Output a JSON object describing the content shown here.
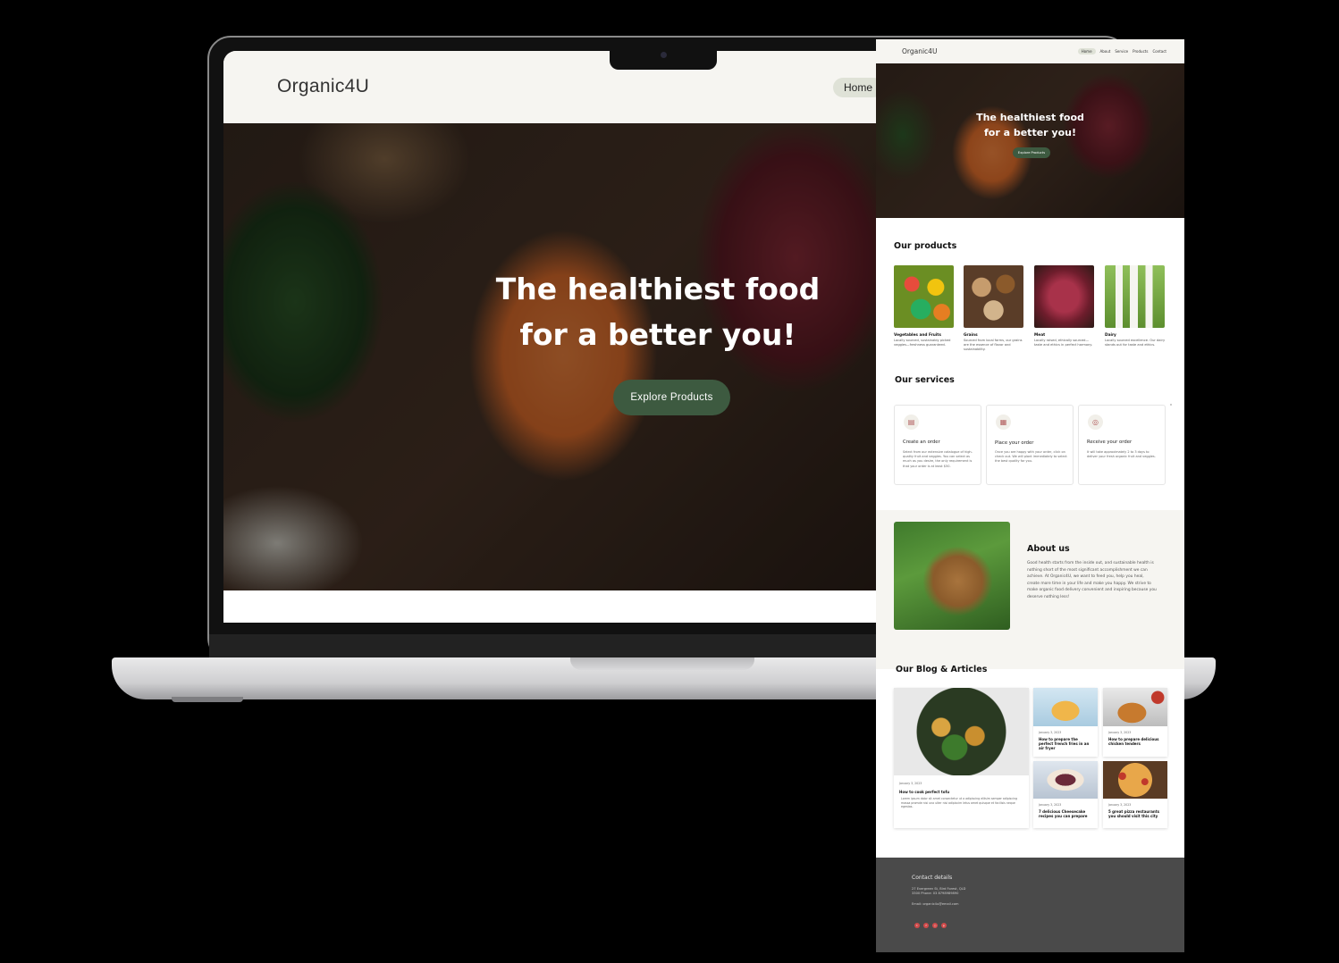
{
  "desktop": {
    "logo": "Organic4U",
    "nav_home": "Home",
    "hero_line1": "The healthiest food",
    "hero_line2": "for a better you!",
    "hero_button": "Explore  Products"
  },
  "page": {
    "logo": "Organic4U",
    "nav": [
      "Home",
      "About",
      "Service",
      "Products",
      "Contact"
    ],
    "hero_line1": "The healthiest food",
    "hero_line2": "for a better you!",
    "hero_button": "Explore  Products",
    "products_title": "Our products",
    "products": [
      {
        "name": "Vegetables and Fruits",
        "desc": "Locally sourced, sustainably picked veggies—freshness guaranteed."
      },
      {
        "name": "Grains",
        "desc": "Sourced from local farms, our grains are the essence of flavor and sustainability."
      },
      {
        "name": "Meat",
        "desc": "Locally raised, ethically sourced—taste and ethics in perfect harmony."
      },
      {
        "name": "Dairy",
        "desc": "Locally sourced excellence. Our dairy stands out for taste and ethics."
      }
    ],
    "services_title": "Our services",
    "services": [
      {
        "title": "Create an order",
        "desc": "Select from our extensive catalogue of high- quality fruit and veggies. You can select as much as you desire, the only requirement is that your order is at least $50."
      },
      {
        "title": "Place your order",
        "desc": "Once you are happy with your order, click on check out. We will plant immediately to select the best quality for you."
      },
      {
        "title": "Receive your order",
        "desc": "It will take approximately 2 to 3 days to deliver your fresh organic fruit and veggies."
      }
    ],
    "about_title": "About us",
    "about_text": "Good health starts from the inside out, and sustainable health is nothing short of the most significant accomplishment we can achieve. At Organic4U, we want to feed you, help you heal, create more time in your life and make you happy. We strive to make organic food delivery convenient and inspiring because you deserve nothing less!",
    "blog_title": "Our Blog & Articles",
    "blog": [
      {
        "date": "January 3, 2023",
        "title": "How to cook perfect tofu",
        "excerpt": "Lorem ipsum dolor sit amet consectetur ut a adipiscing elitsim semper adipiscing massa promde nisi una ulter nisi adipiscim letus amet quisque et facilisis neque egestas."
      },
      {
        "date": "January 3, 2023",
        "title": "How to prepare the perfect french fries in an air fryer"
      },
      {
        "date": "January 3, 2023",
        "title": "How to prepare delicious chicken tenders"
      },
      {
        "date": "January 3, 2023",
        "title": "7 delicious Cheesecake recipes you can prepare"
      },
      {
        "date": "January 3, 2023",
        "title": "5 great pizza restaurants you should visit this city"
      }
    ],
    "footer_title": "Contact details",
    "footer_address": "27 Evergreen St, Bird Forest, QLD",
    "footer_phone": "3300 Phone: 03 8798989890",
    "footer_email": "Email: organic4u@email.com",
    "social_icons": [
      "twitter-icon",
      "facebook-icon",
      "instagram-icon",
      "pinterest-icon"
    ]
  },
  "colors": {
    "accent_green": "#3d5a40",
    "header_bg": "#f6f5f1",
    "nav_active": "#dfe2d7",
    "footer_bg": "#4a4a4a"
  }
}
